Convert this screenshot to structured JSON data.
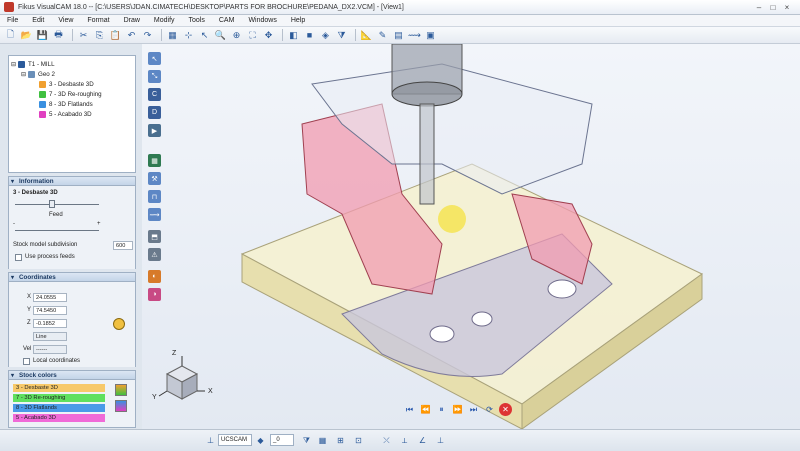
{
  "window": {
    "title": "Fikus VisualCAM 18.0 -- [C:\\USERS\\JDAN.CIMATECH\\DESKTOP\\PARTS FOR BROCHURE\\PEDANA_DX2.VCM] - [View1]",
    "controls": [
      "–",
      "□",
      "×"
    ]
  },
  "menu": [
    "File",
    "Edit",
    "View",
    "Format",
    "Draw",
    "Modify",
    "Tools",
    "CAM",
    "Windows",
    "Help"
  ],
  "tree": {
    "root": "T1 - MILL",
    "group": "Geo 2",
    "items": [
      {
        "label": "3 - Desbaste 3D",
        "color": "#f0a030"
      },
      {
        "label": "7 - 3D Re-roughing",
        "color": "#40c040"
      },
      {
        "label": "8 - 3D Flatlands",
        "color": "#3a90e0"
      },
      {
        "label": "5 - Acabado 3D",
        "color": "#e040c0"
      }
    ]
  },
  "information": {
    "header": "Information",
    "operation": "3 - Desbaste 3D",
    "feed_label": "Feed",
    "minus": "-",
    "plus": "+",
    "subdivision_label": "Stock model subdivision",
    "subdivision_value": "600",
    "process_feeds_label": "Use process feeds"
  },
  "coordinates": {
    "header": "Coordinates",
    "x_label": "X",
    "x_value": "24.0555",
    "y_label": "Y",
    "y_value": "74.5450",
    "z_label": "Z",
    "z_value": "-0.1852",
    "type_value": "Line",
    "vel_label": "Vel",
    "vel_value": "------",
    "local_label": "Local coordinates"
  },
  "stock_colors": {
    "header": "Stock colors",
    "items": [
      {
        "label": "3 - Desbaste 3D",
        "color": "#f7c96a"
      },
      {
        "label": "7 - 3D Re-roughing",
        "color": "#5fe05f"
      },
      {
        "label": "8 - 3D Flatlands",
        "color": "#4a9ae8"
      },
      {
        "label": "5 - Acabado 3D",
        "color": "#f06ad8"
      }
    ]
  },
  "axes": {
    "z": "Z",
    "x": "X",
    "y": "Y"
  },
  "playback": [
    "⏮",
    "⏪",
    "⏸",
    "⏩",
    "⏭",
    "⟳",
    "✕"
  ],
  "status": {
    "ucs_value": "UCSCAM",
    "layer_value": "_0"
  },
  "icons": {
    "accent": "#2b5a9a"
  }
}
